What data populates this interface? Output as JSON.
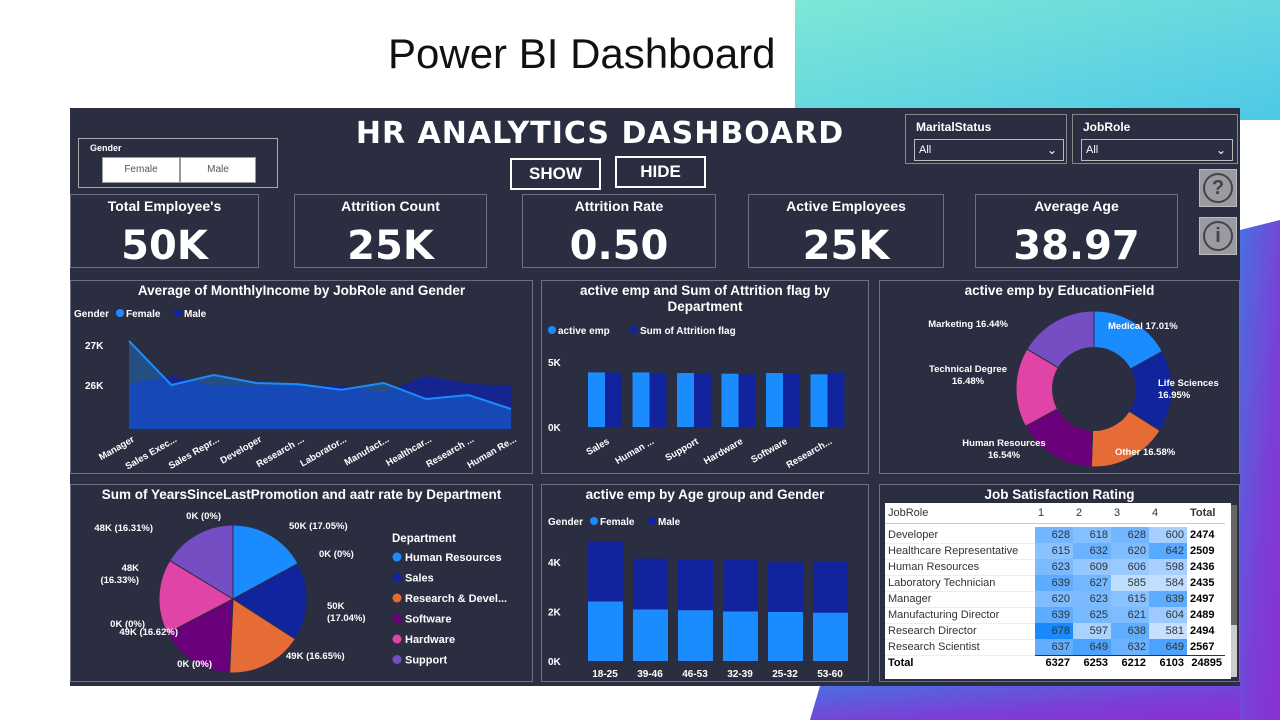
{
  "slide_title": "Power BI Dashboard",
  "dashboard_title": "HR ANALYTICS DASHBOARD",
  "gender_slicer": {
    "label": "Gender",
    "options": [
      "Female",
      "Male"
    ]
  },
  "buttons": {
    "show": "SHOW",
    "hide": "HIDE"
  },
  "marital": {
    "label": "MaritalStatus",
    "value": "All"
  },
  "jobrole": {
    "label": "JobRole",
    "value": "All"
  },
  "kpis": [
    {
      "label": "Total Employee's",
      "value": "50K"
    },
    {
      "label": "Attrition Count",
      "value": "25K"
    },
    {
      "label": "Attrition Rate",
      "value": "0.50"
    },
    {
      "label": "Active Employees",
      "value": "25K"
    },
    {
      "label": "Average Age",
      "value": "38.97"
    }
  ],
  "chart_data": [
    {
      "type": "area",
      "title": "Average of MonthlyIncome by JobRole and Gender",
      "legend_title": "Gender",
      "categories": [
        "Manager",
        "Sales Exec...",
        "Sales Repr...",
        "Developer",
        "Research ...",
        "Laborator...",
        "Manufact...",
        "Healthcar...",
        "Research ...",
        "Human Re..."
      ],
      "yticks": [
        "27K",
        "26K"
      ],
      "ylim": [
        25400,
        27300
      ],
      "series": [
        {
          "name": "Female",
          "values": [
            27100,
            26000,
            26250,
            26050,
            26020,
            25880,
            26050,
            25650,
            25750,
            25400
          ]
        },
        {
          "name": "Male",
          "values": [
            26000,
            26200,
            25950,
            25950,
            25950,
            25950,
            25780,
            26200,
            26000,
            25950
          ]
        }
      ]
    },
    {
      "type": "bar",
      "title": "active emp and Sum of Attrition flag by Department",
      "categories": [
        "Sales",
        "Human ...",
        "Support",
        "Hardware",
        "Software",
        "Research..."
      ],
      "yticks": [
        "5K",
        "0K"
      ],
      "ylim": [
        0,
        5000
      ],
      "series": [
        {
          "name": "active emp",
          "values": [
            4200,
            4200,
            4150,
            4100,
            4150,
            4050
          ]
        },
        {
          "name": "Sum of Attrition flag",
          "values": [
            4200,
            4150,
            4100,
            4050,
            4100,
            4200
          ]
        }
      ]
    },
    {
      "type": "pie",
      "title": "active emp by EducationField",
      "slices": [
        {
          "label": "Medical 17.01%",
          "value": 17.01
        },
        {
          "label": "Life Sciences 16.95%",
          "value": 16.95
        },
        {
          "label": "Other 16.58%",
          "value": 16.58
        },
        {
          "label": "Human Resources 16.54%",
          "value": 16.54
        },
        {
          "label": "Technical Degree 16.48%",
          "value": 16.48
        },
        {
          "label": "Marketing 16.44%",
          "value": 16.44
        }
      ]
    },
    {
      "type": "pie",
      "title": "Sum of YearsSinceLastPromotion and aatr rate by Department",
      "legend_title": "Department",
      "legend": [
        "Human Resources",
        "Sales",
        "Research & Devel...",
        "Software",
        "Hardware",
        "Support"
      ],
      "slices": [
        {
          "label": "50K (17.05%)",
          "value": 17.05
        },
        {
          "label": "0K (0%)",
          "value": 0
        },
        {
          "label": "50K (17.04%)",
          "value": 17.04
        },
        {
          "label": "49K (16.65%)",
          "value": 16.65
        },
        {
          "label": "0K (0%)",
          "value": 0
        },
        {
          "label": "49K (16.62%)",
          "value": 16.62
        },
        {
          "label": "0K (0%)",
          "value": 0
        },
        {
          "label": "48K (16.33%)",
          "value": 16.33
        },
        {
          "label": "48K (16.31%)",
          "value": 16.31
        },
        {
          "label": "0K (0%)",
          "value": 0
        }
      ]
    },
    {
      "type": "bar",
      "title": "active emp by Age group and Gender",
      "legend_title": "Gender",
      "categories": [
        "18-25",
        "39-46",
        "46-53",
        "32-39",
        "25-32",
        "53-60"
      ],
      "yticks": [
        "4K",
        "2K",
        "0K"
      ],
      "ylim": [
        0,
        5000
      ],
      "series": [
        {
          "name": "Female",
          "values": [
            2400,
            2080,
            2050,
            2000,
            1980,
            1950
          ]
        },
        {
          "name": "Male",
          "values": [
            2400,
            2050,
            2050,
            2100,
            2000,
            2050
          ]
        }
      ]
    },
    {
      "type": "table",
      "title": "Job Satisfaction Rating",
      "columns": [
        "JobRole",
        "1",
        "2",
        "3",
        "4",
        "Total"
      ],
      "rows": [
        [
          "Developer",
          "628",
          "618",
          "628",
          "600",
          "2474"
        ],
        [
          "Healthcare Representative",
          "615",
          "632",
          "620",
          "642",
          "2509"
        ],
        [
          "Human Resources",
          "623",
          "609",
          "606",
          "598",
          "2436"
        ],
        [
          "Laboratory Technician",
          "639",
          "627",
          "585",
          "584",
          "2435"
        ],
        [
          "Manager",
          "620",
          "623",
          "615",
          "639",
          "2497"
        ],
        [
          "Manufacturing Director",
          "639",
          "625",
          "621",
          "604",
          "2489"
        ],
        [
          "Research Director",
          "678",
          "597",
          "638",
          "581",
          "2494"
        ],
        [
          "Research Scientist",
          "637",
          "649",
          "632",
          "649",
          "2567"
        ]
      ],
      "total": [
        "Total",
        "6327",
        "6253",
        "6212",
        "6103",
        "24895"
      ]
    }
  ],
  "colors": {
    "female": "#1a8cff",
    "male": "#12239e",
    "panel": "#2b2e40"
  }
}
